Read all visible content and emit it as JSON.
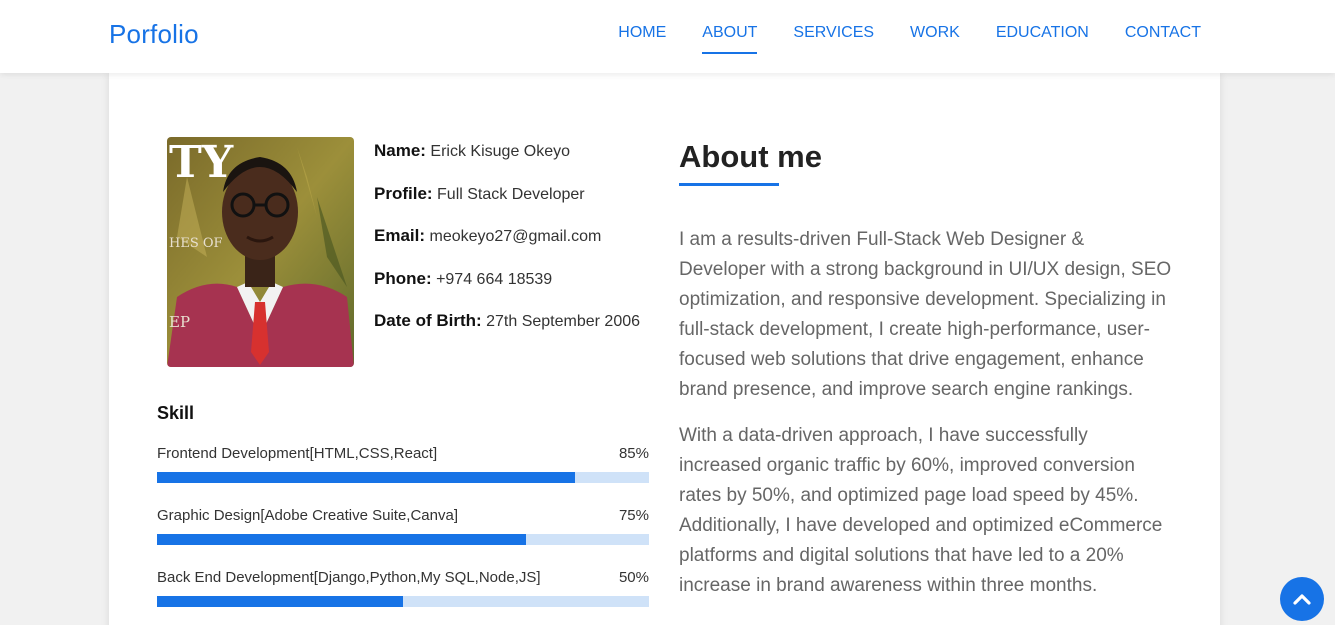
{
  "nav": {
    "brand": "Porfolio",
    "links": [
      "HOME",
      "ABOUT",
      "SERVICES",
      "WORK",
      "EDUCATION",
      "CONTACT"
    ],
    "active": "ABOUT"
  },
  "profile": {
    "photo_overlay_text": [
      "TY",
      "HES OF",
      "EP"
    ],
    "fields": [
      {
        "label": "Name:",
        "value": "Erick Kisuge Okeyo"
      },
      {
        "label": "Profile:",
        "value": "Full Stack Developer"
      },
      {
        "label": "Email:",
        "value": "meokeyo27@gmail.com"
      },
      {
        "label": "Phone:",
        "value": "+974 664 18539"
      },
      {
        "label": "Date of Birth:",
        "value": "27th September 2006"
      }
    ]
  },
  "skills": {
    "title": "Skill",
    "items": [
      {
        "name": "Frontend Development[HTML,CSS,React]",
        "percent_label": "85%",
        "level": 85
      },
      {
        "name": "Graphic Design[Adobe Creative Suite,Canva]",
        "percent_label": "75%",
        "level": 75
      },
      {
        "name": "Back End Development[Django,Python,My SQL,Node,JS]",
        "percent_label": "50%",
        "level": 50
      }
    ]
  },
  "about": {
    "title": "About me",
    "paragraphs": [
      "I am a results-driven Full-Stack Web Designer & Developer with a strong background in UI/UX design, SEO optimization, and responsive development. Specializing in full-stack development, I create high-performance, user-focused web solutions that drive engagement, enhance brand presence, and improve search engine rankings.",
      "With a data-driven approach, I have successfully increased organic traffic by 60%, improved conversion rates by 50%, and optimized page load speed by 45%. Additionally, I have developed and optimized eCommerce platforms and digital solutions that have led to a 20% increase in brand awareness within three months."
    ]
  },
  "back_to_top": {
    "icon": "chevron-up-icon"
  },
  "colors": {
    "accent": "#1773e6",
    "track": "#cfe2f8"
  }
}
